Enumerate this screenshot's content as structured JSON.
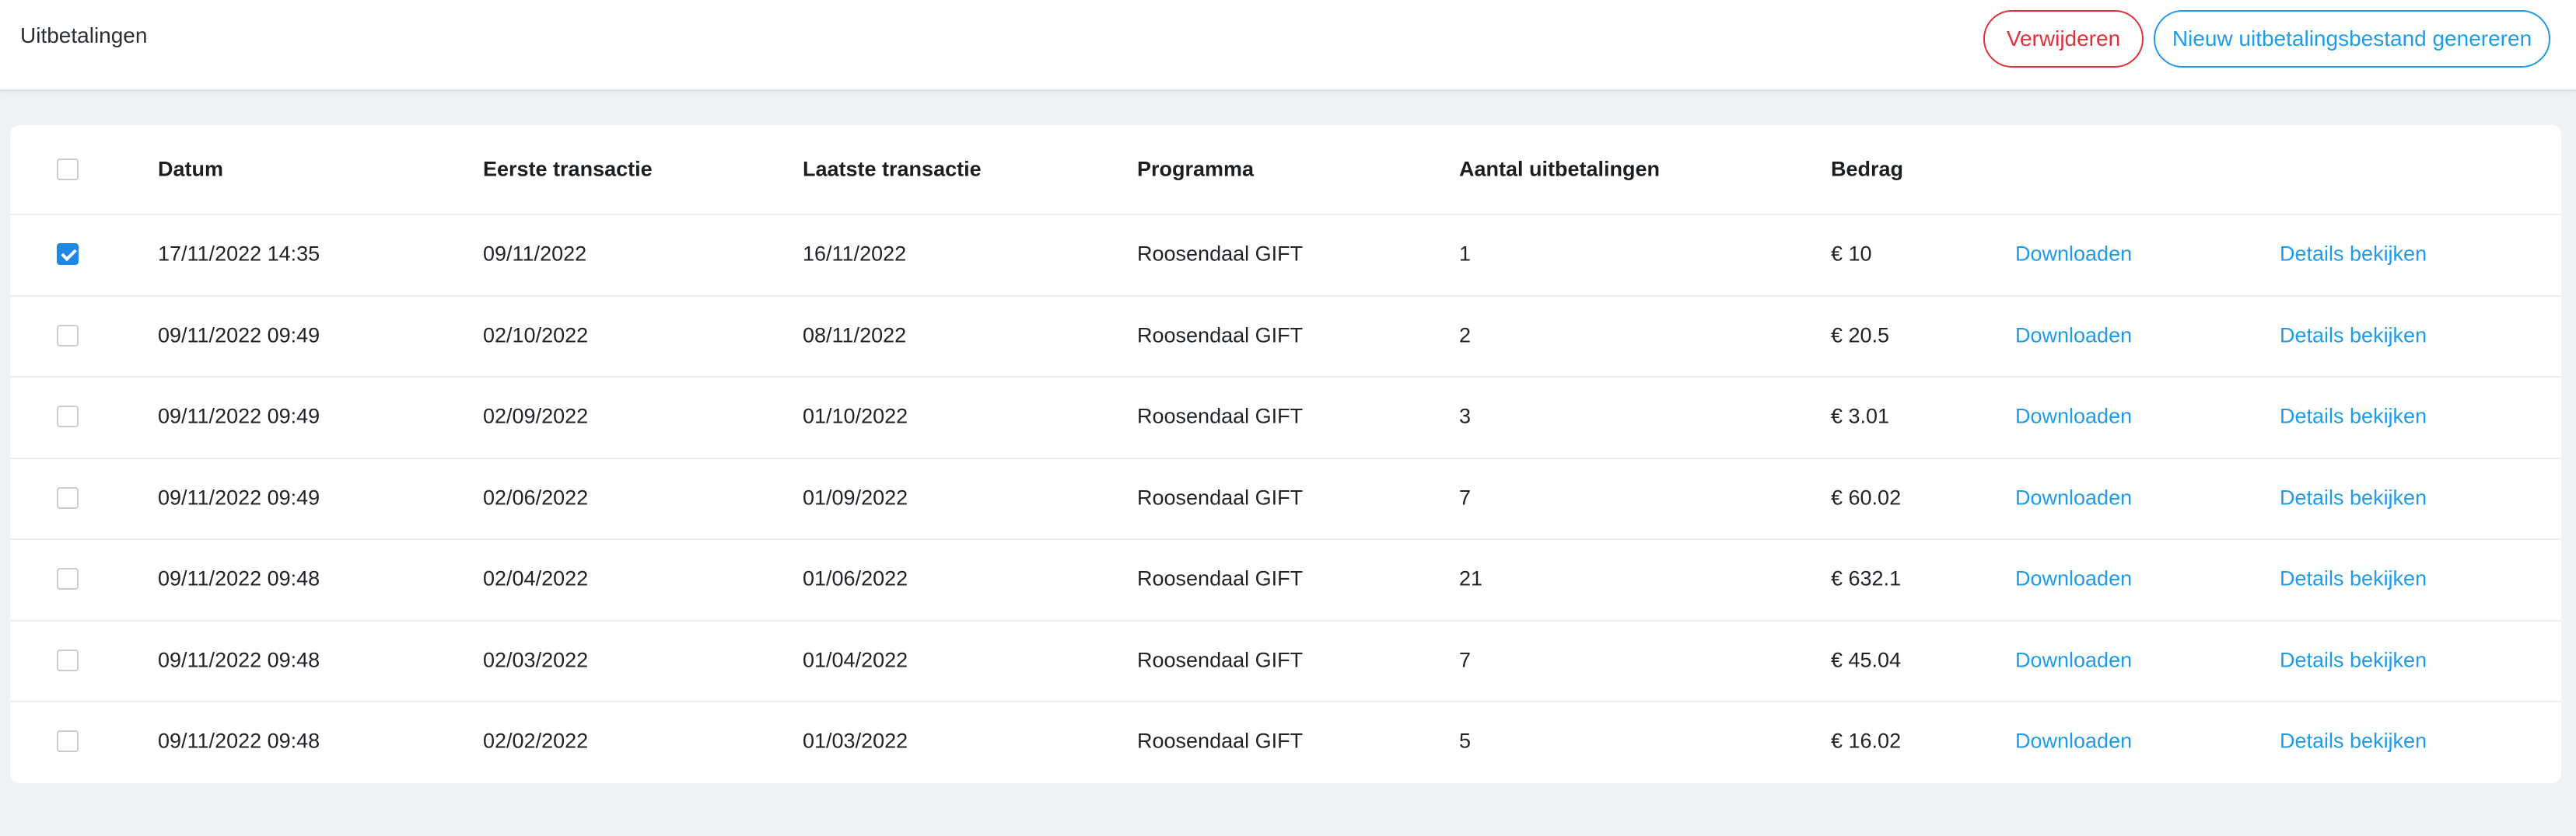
{
  "header": {
    "title": "Uitbetalingen",
    "delete_label": "Verwijderen",
    "generate_label": "Nieuw uitbetalingsbestand genereren"
  },
  "table": {
    "columns": {
      "datum": "Datum",
      "eerste": "Eerste transactie",
      "laatste": "Laatste transactie",
      "programma": "Programma",
      "aantal": "Aantal uitbetalingen",
      "bedrag": "Bedrag"
    },
    "header_checked": false,
    "rows": [
      {
        "checked": true,
        "datum": "17/11/2022 14:35",
        "eerste": "09/11/2022",
        "laatste": "16/11/2022",
        "programma": "Roosendaal GIFT",
        "aantal": "1",
        "bedrag": "€ 10",
        "download": "Downloaden",
        "details": "Details bekijken"
      },
      {
        "checked": false,
        "datum": "09/11/2022 09:49",
        "eerste": "02/10/2022",
        "laatste": "08/11/2022",
        "programma": "Roosendaal GIFT",
        "aantal": "2",
        "bedrag": "€ 20.5",
        "download": "Downloaden",
        "details": "Details bekijken"
      },
      {
        "checked": false,
        "datum": "09/11/2022 09:49",
        "eerste": "02/09/2022",
        "laatste": "01/10/2022",
        "programma": "Roosendaal GIFT",
        "aantal": "3",
        "bedrag": "€ 3.01",
        "download": "Downloaden",
        "details": "Details bekijken"
      },
      {
        "checked": false,
        "datum": "09/11/2022 09:49",
        "eerste": "02/06/2022",
        "laatste": "01/09/2022",
        "programma": "Roosendaal GIFT",
        "aantal": "7",
        "bedrag": "€ 60.02",
        "download": "Downloaden",
        "details": "Details bekijken"
      },
      {
        "checked": false,
        "datum": "09/11/2022 09:48",
        "eerste": "02/04/2022",
        "laatste": "01/06/2022",
        "programma": "Roosendaal GIFT",
        "aantal": "21",
        "bedrag": "€ 632.1",
        "download": "Downloaden",
        "details": "Details bekijken"
      },
      {
        "checked": false,
        "datum": "09/11/2022 09:48",
        "eerste": "02/03/2022",
        "laatste": "01/04/2022",
        "programma": "Roosendaal GIFT",
        "aantal": "7",
        "bedrag": "€ 45.04",
        "download": "Downloaden",
        "details": "Details bekijken"
      },
      {
        "checked": false,
        "datum": "09/11/2022 09:48",
        "eerste": "02/02/2022",
        "laatste": "01/03/2022",
        "programma": "Roosendaal GIFT",
        "aantal": "5",
        "bedrag": "€ 16.02",
        "download": "Downloaden",
        "details": "Details bekijken"
      }
    ]
  },
  "colors": {
    "accent": "#1e9be9",
    "danger": "#e0303a",
    "checkbox_checked": "#1e88e5",
    "page_background": "#eef2f6"
  }
}
